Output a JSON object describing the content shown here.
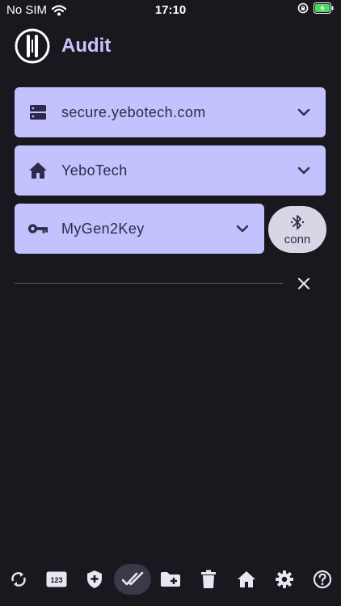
{
  "status_bar": {
    "carrier": "No SIM",
    "time": "17:10"
  },
  "header": {
    "title": "Audit",
    "logo_icon": "rune-logo-icon"
  },
  "selects": {
    "server": {
      "value": "secure.yebotech.com",
      "icon": "server-icon"
    },
    "domain": {
      "value": "YeboTech",
      "icon": "home-icon"
    },
    "key": {
      "value": "MyGen2Key",
      "icon": "key-icon"
    }
  },
  "connect": {
    "label": "conn",
    "icon": "bluetooth-icon"
  },
  "filter": {
    "value": ""
  },
  "toolbar": {
    "items": [
      {
        "icon": "sync-icon"
      },
      {
        "icon": "numbers-icon",
        "label": "123"
      },
      {
        "icon": "shield-plus-icon"
      },
      {
        "icon": "done-all-icon",
        "active": true
      },
      {
        "icon": "folder-plus-icon"
      },
      {
        "icon": "trash-icon"
      },
      {
        "icon": "home-icon"
      },
      {
        "icon": "settings-icon"
      },
      {
        "icon": "help-icon"
      }
    ]
  },
  "colors": {
    "background": "#19181e",
    "accent": "#c4c1ff",
    "title": "#c9c4ff",
    "on_accent": "#2c2c4a",
    "active_tab": "#3a3948"
  }
}
